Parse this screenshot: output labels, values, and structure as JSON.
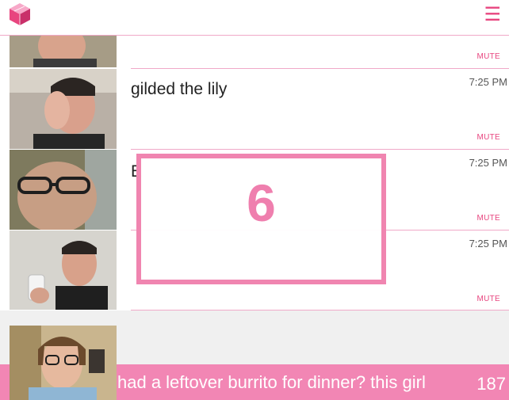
{
  "header": {
    "logo_icon": "pink-cube-logo",
    "menu_icon": "hamburger-menu-icon",
    "menu_glyph": "☰",
    "accent_color": "#e8457f"
  },
  "feed": {
    "messages": [
      {
        "text": "",
        "time": "",
        "mute_label": "MUTE"
      },
      {
        "text": "gilded the lily",
        "time": "7:25 PM",
        "mute_label": "MUTE"
      },
      {
        "text": "E",
        "time": "7:25 PM",
        "mute_label": "MUTE"
      },
      {
        "text": "",
        "time": "7:25 PM",
        "mute_label": "MUTE"
      }
    ]
  },
  "overlay": {
    "number": "6"
  },
  "compose": {
    "text": "had a leftover burrito for dinner? this girl",
    "char_count": "187",
    "bar_color": "#f286b4"
  }
}
